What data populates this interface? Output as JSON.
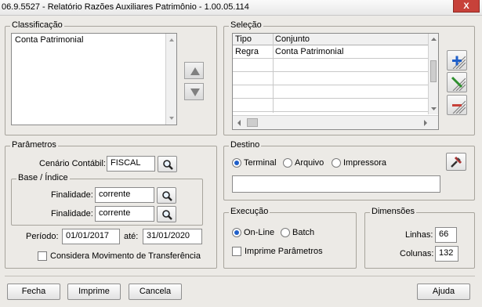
{
  "window": {
    "title": "06.9.5527 - Relatório Razões Auxiliares Patrimônio - 1.00.05.114",
    "close_label": "X"
  },
  "classificacao": {
    "legend": "Classificação",
    "items": [
      "Conta Patrimonial"
    ]
  },
  "selecao": {
    "legend": "Seleção",
    "columns": [
      "Tipo",
      "Conjunto"
    ],
    "rows": [
      [
        "Regra",
        "Conta Patrimonial"
      ]
    ]
  },
  "parametros": {
    "legend": "Parâmetros",
    "cenario_label": "Cenário Contábil:",
    "cenario_value": "FISCAL",
    "base_legend": "Base / Índice",
    "finalidade_label": "Finalidade:",
    "finalidade_1": "corrente",
    "finalidade_2": "corrente",
    "periodo_label": "Período:",
    "periodo_inicio": "01/01/2017",
    "ate_label": "até:",
    "periodo_fim": "31/01/2020",
    "transferencia_label": "Considera Movimento de Transferência",
    "transferencia_checked": false
  },
  "destino": {
    "legend": "Destino",
    "options": [
      "Terminal",
      "Arquivo",
      "Impressora"
    ],
    "selected": "Terminal",
    "path_value": ""
  },
  "execucao": {
    "legend": "Execução",
    "options": [
      "On-Line",
      "Batch"
    ],
    "selected": "On-Line",
    "imprime_parametros_label": "Imprime Parâmetros",
    "imprime_parametros_checked": false
  },
  "dimensoes": {
    "legend": "Dimensões",
    "linhas_label": "Linhas:",
    "linhas_value": "66",
    "colunas_label": "Colunas:",
    "colunas_value": "132"
  },
  "footer": {
    "fecha": "Fecha",
    "imprime": "Imprime",
    "cancela": "Cancela",
    "ajuda": "Ajuda"
  },
  "colors": {
    "accent": "#1f5fc9",
    "close": "#c7413a"
  }
}
